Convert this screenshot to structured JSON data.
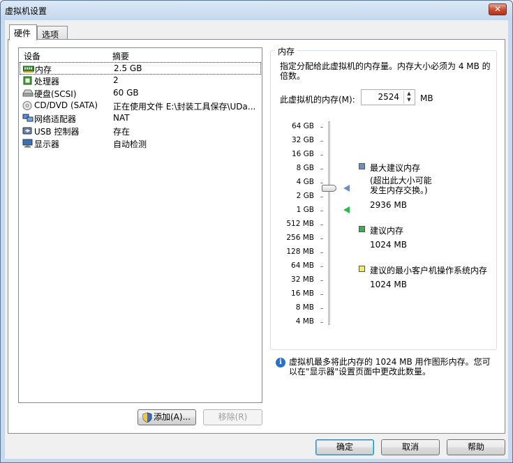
{
  "window": {
    "title": "虚拟机设置",
    "close_glyph": "✕"
  },
  "tabs": [
    {
      "label": "硬件"
    },
    {
      "label": "选项"
    }
  ],
  "devices": {
    "header": {
      "device": "设备",
      "summary": "摘要"
    },
    "rows": [
      {
        "name": "内存",
        "summary": "2.5 GB",
        "icon": "memory-icon"
      },
      {
        "name": "处理器",
        "summary": "2",
        "icon": "processor-icon"
      },
      {
        "name": "硬盘(SCSI)",
        "summary": "60 GB",
        "icon": "hard-disk-icon"
      },
      {
        "name": "CD/DVD (SATA)",
        "summary": "正在使用文件 E:\\封装工具保存\\UDa...",
        "icon": "cd-dvd-icon"
      },
      {
        "name": "网络适配器",
        "summary": "NAT",
        "icon": "network-adapter-icon"
      },
      {
        "name": "USB 控制器",
        "summary": "存在",
        "icon": "usb-icon"
      },
      {
        "name": "显示器",
        "summary": "自动检测",
        "icon": "display-icon"
      }
    ],
    "add_label": "添加(A)...",
    "remove_label": "移除(R)"
  },
  "memory": {
    "group_label": "内存",
    "description": "指定分配给此虚拟机的内存量。内存大小必须为 4 MB 的倍数。",
    "field_label": "此虚拟机的内存(M):",
    "value": "2524",
    "unit": "MB",
    "scale": [
      "64 GB",
      "32 GB",
      "16 GB",
      "8 GB",
      "4 GB",
      "2 GB",
      "1 GB",
      "512 MB",
      "256 MB",
      "128 MB",
      "64 MB",
      "32 MB",
      "16 MB",
      "8 MB",
      "4 MB"
    ],
    "legend": {
      "max_title": "最大建议内存",
      "max_note": "(超出此大小可能发生内存交换。)",
      "max_value": "2936 MB",
      "rec_title": "建议内存",
      "rec_value": "1024 MB",
      "min_title": "建议的最小客户机操作系统内存",
      "min_value": "1024 MB"
    },
    "colors": {
      "max": "#6b8fc4",
      "rec": "#2fb84a",
      "min": "#f2e86a"
    },
    "info": "虚拟机最多将此内存的 1024 MB 用作图形内存。您可以在\"显示器\"设置页面中更改此数量。"
  },
  "footer": {
    "ok": "确定",
    "cancel": "取消",
    "help": "帮助"
  }
}
